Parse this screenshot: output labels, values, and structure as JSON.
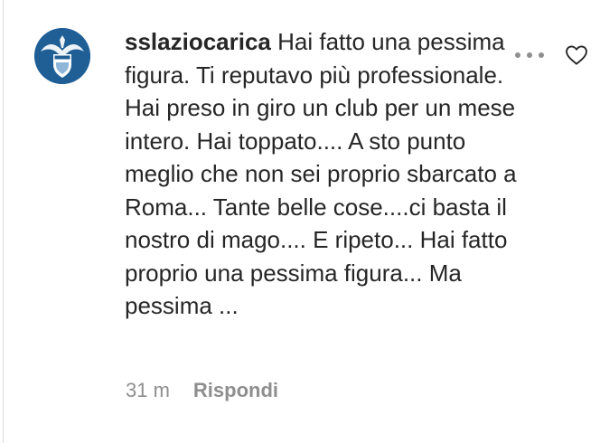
{
  "comment": {
    "username": "sslaziocarica",
    "text": "Hai fatto una pessima figura. Ti reputavo più professionale. Hai preso in giro un club per un mese intero. Hai toppato.... A sto punto meglio che non sei proprio sbarcato a Roma... Tante belle cose....ci basta il nostro di mago.... E ripeto... Hai fatto proprio una pessima figura... Ma pessima ...",
    "timestamp": "31 m",
    "reply_label": "Rispondi"
  },
  "icons": {
    "avatar": "lazio-eagle-logo-icon",
    "more": "more-options-icon",
    "like": "heart-outline-icon"
  },
  "colors": {
    "avatar_bg": "#1f5f95",
    "text": "#262626",
    "secondary": "#8e8e8e"
  }
}
